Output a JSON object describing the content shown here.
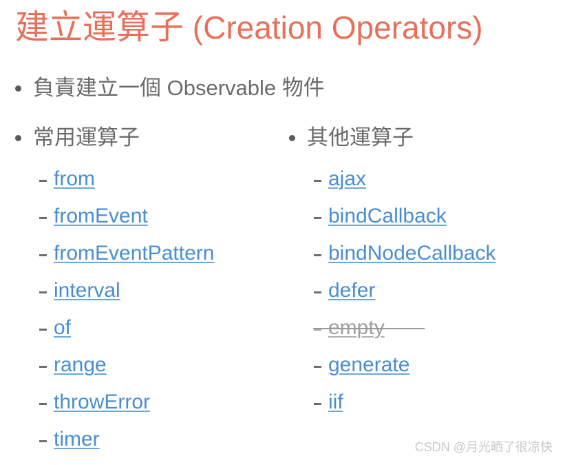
{
  "slide": {
    "title": {
      "cjk": "建立運算子",
      "english": " (Creation Operators)",
      "color": "#e8705a"
    },
    "lead_bullet": "負責建立一個 Observable 物件",
    "columns": [
      {
        "heading": "常用運算子",
        "items": [
          {
            "label": "from",
            "deprecated": false
          },
          {
            "label": "fromEvent",
            "deprecated": false
          },
          {
            "label": "fromEventPattern",
            "deprecated": false
          },
          {
            "label": "interval",
            "deprecated": false
          },
          {
            "label": "of",
            "deprecated": false
          },
          {
            "label": "range",
            "deprecated": false
          },
          {
            "label": "throwError",
            "deprecated": false
          },
          {
            "label": "timer",
            "deprecated": false
          }
        ]
      },
      {
        "heading": "其他運算子",
        "items": [
          {
            "label": "ajax",
            "deprecated": false
          },
          {
            "label": "bindCallback",
            "deprecated": false
          },
          {
            "label": "bindNodeCallback",
            "deprecated": false
          },
          {
            "label": "defer",
            "deprecated": false
          },
          {
            "label": "empty",
            "deprecated": true
          },
          {
            "label": "generate",
            "deprecated": false
          },
          {
            "label": "iif",
            "deprecated": false
          }
        ]
      }
    ],
    "watermark": "CSDN @月光晒了很凉快",
    "colors": {
      "title": "#e8705a",
      "link": "#4a8ed0",
      "body_text": "#6b6b6b",
      "deprecated": "#9e9e9e",
      "background": "#ffffff"
    }
  }
}
